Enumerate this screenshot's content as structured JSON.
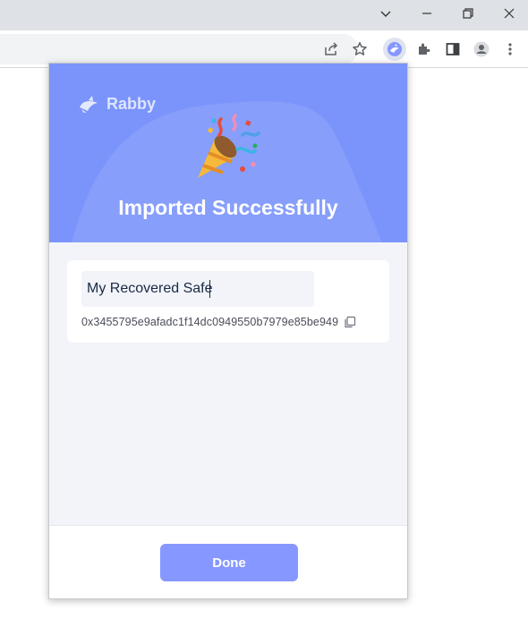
{
  "browser": {
    "window_controls": {
      "tabs_menu": "chevron-down-icon",
      "minimize": "minimize-icon",
      "restore": "restore-icon",
      "close": "close-icon"
    },
    "toolbar_icons": [
      "share-icon",
      "bookmark-star-icon",
      "rabby-extension-icon",
      "extensions-puzzle-icon",
      "side-panel-icon",
      "profile-icon",
      "more-menu-icon"
    ]
  },
  "popup": {
    "brand": {
      "name": "Rabby",
      "icon": "rabbit-logo-icon"
    },
    "hero": {
      "emoji": "party-popper",
      "title": "Imported Successfully"
    },
    "account": {
      "name_value": "My Recovered Safe",
      "address": "0x3455795e9afadc1f14dc0949550b7979e85be949",
      "copy_icon": "copy-icon"
    },
    "footer": {
      "done_label": "Done"
    }
  },
  "colors": {
    "hero_bg": "#7a94fb",
    "primary_button": "#8697ff",
    "popup_bg": "#f2f4f9",
    "title_text": "#ffffff"
  }
}
